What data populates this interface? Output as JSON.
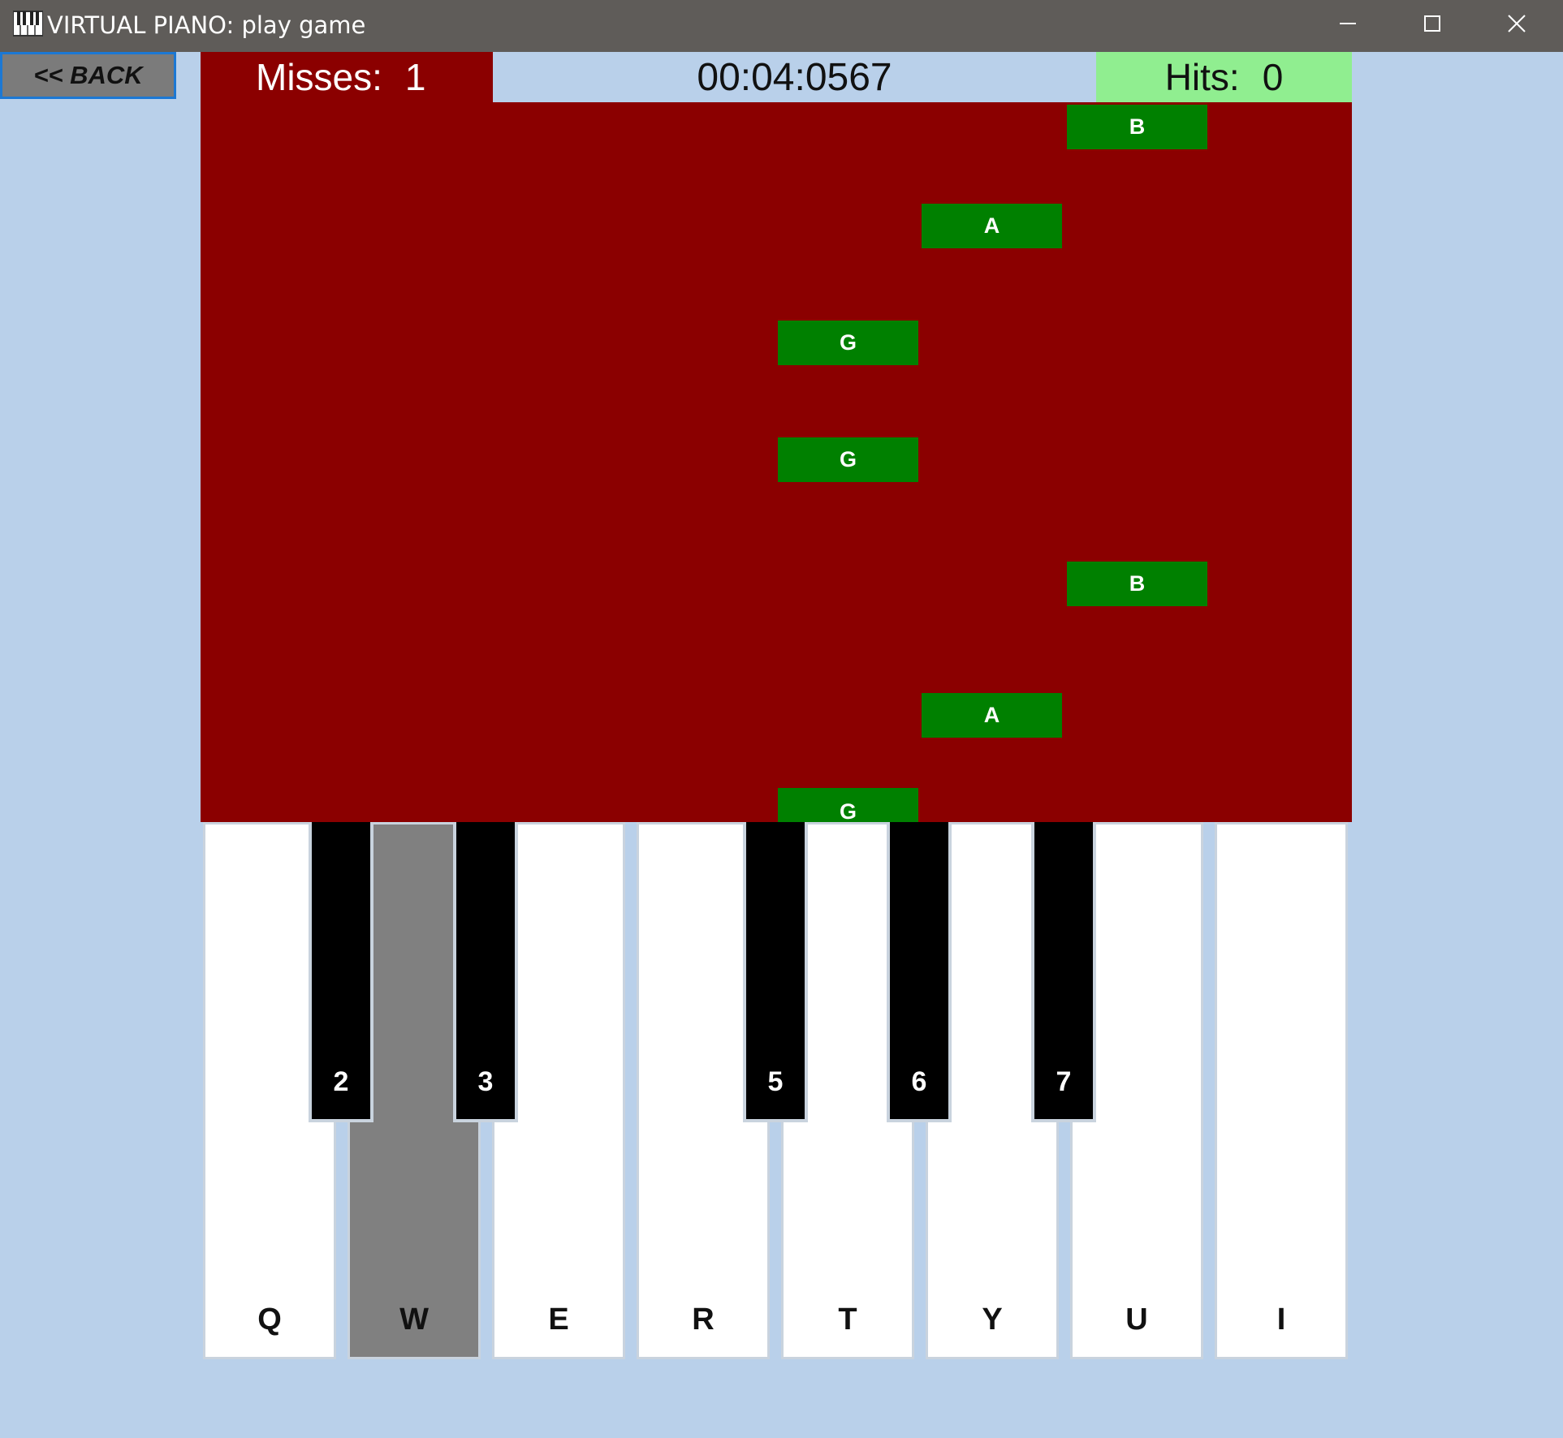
{
  "window": {
    "title": "VIRTUAL PIANO: play game"
  },
  "nav": {
    "back_label": "<< BACK"
  },
  "scoreboard": {
    "misses_label": "Misses:",
    "misses_value": "1",
    "timer": "00:04:0567",
    "hits_label": "Hits:",
    "hits_value": "0"
  },
  "notes": [
    "B",
    "A",
    "G",
    "G",
    "B",
    "A",
    "G"
  ],
  "keyboard": {
    "white_keys": [
      "Q",
      "W",
      "E",
      "R",
      "T",
      "Y",
      "U",
      "I"
    ],
    "black_keys": [
      "2",
      "3",
      "5",
      "6",
      "7"
    ],
    "pressed_key": "W"
  },
  "colors": {
    "background": "#b9d0ea",
    "stage": "#8b0000",
    "note": "#008000",
    "hits_panel": "#90ee90",
    "pressed_key": "#808080"
  }
}
